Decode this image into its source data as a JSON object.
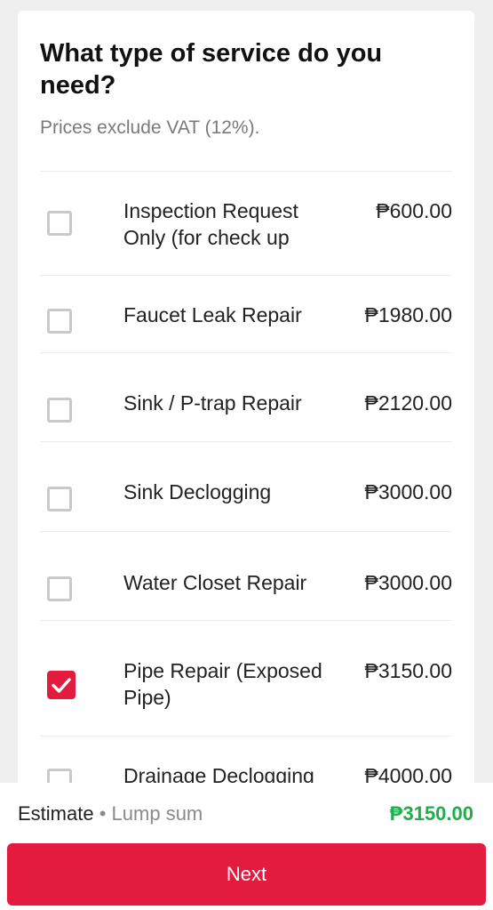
{
  "form": {
    "title": "What type of service do you need?",
    "subtitle": "Prices exclude VAT (12%)."
  },
  "services": [
    {
      "label": "Inspection Request Only (for check up",
      "price": "₱600.00",
      "checked": false
    },
    {
      "label": "Faucet Leak Repair",
      "price": "₱1980.00",
      "checked": false
    },
    {
      "label": "Sink / P-trap Repair",
      "price": "₱2120.00",
      "checked": false
    },
    {
      "label": "Sink Declogging",
      "price": "₱3000.00",
      "checked": false
    },
    {
      "label": "Water Closet Repair",
      "price": "₱3000.00",
      "checked": false
    },
    {
      "label": "Pipe Repair (Exposed Pipe)",
      "price": "₱3150.00",
      "checked": true
    },
    {
      "label": "Drainage Declogging",
      "price": "₱4000.00",
      "checked": false
    }
  ],
  "footer": {
    "estimate_label": "Estimate",
    "separator": "•",
    "estimate_type": "Lump sum",
    "estimate_price": "₱3150.00",
    "next_label": "Next"
  },
  "colors": {
    "accent": "#e31b3f",
    "price_green": "#1fae4b"
  }
}
